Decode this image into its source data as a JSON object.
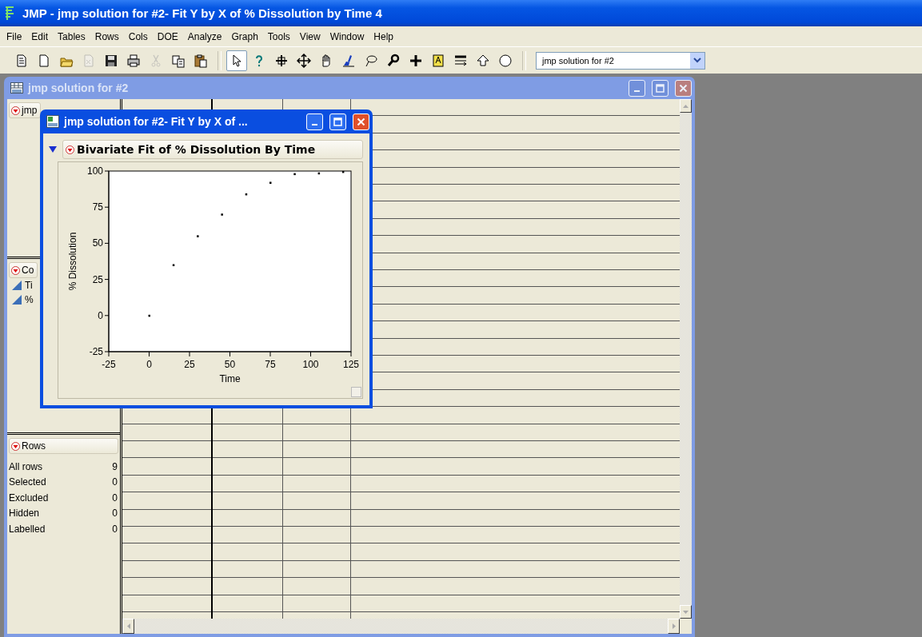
{
  "window": {
    "title": "JMP - jmp solution for #2- Fit Y by X of % Dissolution by Time 4"
  },
  "menu": [
    "File",
    "Edit",
    "Tables",
    "Rows",
    "Cols",
    "DOE",
    "Analyze",
    "Graph",
    "Tools",
    "View",
    "Window",
    "Help"
  ],
  "toolbar": {
    "buttons": [
      {
        "disabled": false
      },
      {
        "disabled": false
      },
      {
        "disabled": false
      },
      {
        "disabled": true
      },
      {
        "disabled": false
      },
      {
        "disabled": false
      },
      {
        "disabled": true
      },
      {
        "disabled": false
      },
      {
        "disabled": false
      }
    ],
    "tools": [
      {
        "selected": true
      },
      {
        "selected": false
      },
      {
        "selected": false
      },
      {
        "selected": false
      },
      {
        "selected": false
      },
      {
        "selected": false
      },
      {
        "selected": false
      },
      {
        "selected": false
      },
      {
        "selected": false
      },
      {
        "selected": false
      },
      {
        "selected": false
      },
      {
        "selected": false
      },
      {
        "selected": false
      }
    ],
    "document_selector": {
      "value": "jmp solution for #2"
    }
  },
  "data_window": {
    "title": "jmp solution for #2",
    "active": false,
    "table_panel": {
      "title": "jmp"
    },
    "columns_panel": {
      "title": "Co",
      "columns": [
        "Ti",
        "%"
      ]
    },
    "rows_panel": {
      "title": "Rows",
      "stats": [
        {
          "label": "All rows",
          "value": "9"
        },
        {
          "label": "Selected",
          "value": "0"
        },
        {
          "label": "Excluded",
          "value": "0"
        },
        {
          "label": "Hidden",
          "value": "0"
        },
        {
          "label": "Labelled",
          "value": "0"
        }
      ]
    }
  },
  "report_window": {
    "title": "jmp solution for #2- Fit Y by X of ...",
    "active": true,
    "outline": {
      "title": "Bivariate Fit of % Dissolution By Time",
      "expanded": true
    },
    "chart_data": {
      "type": "scatter",
      "xlabel": "Time",
      "ylabel": "% Dissolution",
      "xlim": [
        -25,
        125
      ],
      "ylim": [
        -25,
        100
      ],
      "xticks": [
        -25,
        0,
        25,
        50,
        75,
        100,
        125
      ],
      "yticks": [
        -25,
        0,
        25,
        50,
        75,
        100
      ],
      "x": [
        0,
        15,
        30,
        45,
        60,
        75,
        90,
        105,
        120
      ],
      "series": [
        {
          "color": "#000000",
          "values": [
            0,
            35,
            55,
            70,
            84,
            92,
            98,
            98.5,
            99.5
          ]
        }
      ]
    }
  }
}
